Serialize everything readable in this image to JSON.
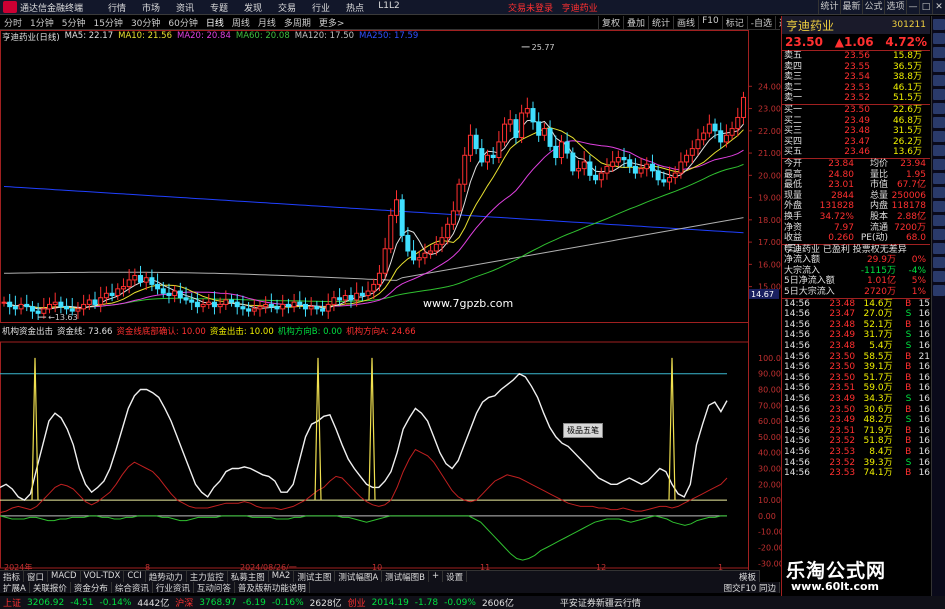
{
  "app": {
    "title": "通达信金融终端",
    "menu": [
      "行情",
      "市场",
      "资讯",
      "专题",
      "发现",
      "交易",
      "行业",
      "热点",
      "L1L2"
    ],
    "trade_warning": "交易未登录",
    "stock_in_title": "亨迪药业",
    "win_buttons": [
      "统计",
      "最新",
      "公式",
      "选项",
      "—",
      "□",
      "✕"
    ]
  },
  "toolbar": {
    "periods": [
      "分时",
      "1分钟",
      "5分钟",
      "15分钟",
      "30分钟",
      "60分钟",
      "日线",
      "周线",
      "月线",
      "多周期",
      "更多>"
    ],
    "active": "日线",
    "right": [
      "复权",
      "叠加",
      "统计",
      "画线",
      "F10",
      "标记",
      "-自选",
      "返回"
    ]
  },
  "legend": {
    "name": "亨迪药业(日线)",
    "ma5": "MA5: 22.17",
    "ma10": "MA10: 21.56",
    "ma20": "MA20: 20.84",
    "ma60": "MA60: 20.08",
    "ma120": "MA120: 17.50",
    "ma250": "MA250: 17.59"
  },
  "indicator": {
    "name": "机构资金出击",
    "line1": "资金线: 73.66",
    "line2": "资金线底部确认: 10.00",
    "line3": "资金出击: 10.00",
    "line4": "机构方向B: 0.00",
    "line5": "机构方向A: 24.66"
  },
  "chart_data": {
    "type": "candlestick",
    "price_axis": [
      "24.00",
      "23.00",
      "22.00",
      "21.00",
      "20.00",
      "19.00",
      "18.00",
      "17.00",
      "16.00",
      "15.00"
    ],
    "price_tag": "14.67",
    "high_label": "25.77",
    "low_label": "13.63",
    "ind_axis": [
      "100.00",
      "90.00",
      "80.00",
      "70.00",
      "60.00",
      "50.00",
      "40.00",
      "30.00",
      "20.00",
      "10.00",
      "0.00",
      "-10.00",
      "-20.00",
      "-30.00"
    ],
    "x_labels": [
      "2024年",
      "8",
      "2024/08/26/一",
      "10",
      "11",
      "12",
      "1"
    ],
    "watermark_center": "www.7gpzb.com",
    "closes": [
      14.3,
      14.1,
      14.0,
      14.2,
      14.1,
      13.9,
      13.8,
      14.0,
      14.2,
      14.3,
      14.1,
      14.0,
      13.9,
      14.0,
      14.2,
      14.4,
      14.2,
      14.5,
      14.7,
      14.6,
      14.9,
      15.0,
      15.3,
      15.5,
      15.2,
      15.4,
      15.1,
      14.9,
      14.7,
      14.6,
      14.8,
      14.5,
      14.4,
      14.3,
      14.1,
      14.2,
      14.3,
      14.1,
      14.2,
      14.4,
      14.3,
      14.1,
      14.0,
      13.9,
      14.0,
      14.1,
      14.2,
      14.1,
      14.0,
      14.2,
      14.1,
      14.3,
      14.2,
      14.0,
      14.1,
      14.0,
      13.9,
      14.2,
      14.5,
      14.4,
      14.6,
      14.4,
      14.7,
      14.6,
      14.8,
      15.1,
      15.6,
      16.7,
      18.2,
      18.9,
      17.3,
      16.6,
      16.2,
      16.3,
      16.5,
      16.6,
      16.9,
      17.2,
      17.8,
      18.4,
      19.6,
      20.9,
      21.8,
      21.2,
      20.6,
      20.9,
      20.8,
      21.5,
      22.3,
      22.5,
      21.7,
      22.8,
      23.0,
      22.4,
      21.8,
      22.1,
      21.3,
      20.8,
      21.5,
      21.0,
      20.2,
      20.3,
      20.6,
      20.0,
      19.8,
      20.1,
      20.4,
      20.6,
      20.8,
      20.7,
      20.4,
      20.1,
      20.3,
      20.5,
      20.2,
      19.8,
      19.7,
      19.9,
      20.1,
      20.6,
      20.9,
      21.2,
      21.6,
      21.9,
      22.3,
      22.0,
      21.5,
      21.8,
      22.1,
      22.6,
      23.5
    ],
    "white_line": [
      18,
      20,
      17,
      12,
      10,
      14,
      30,
      45,
      60,
      65,
      62,
      55,
      45,
      30,
      20,
      15,
      18,
      22,
      30,
      42,
      55,
      68,
      76,
      80,
      80,
      78,
      75,
      68,
      60,
      50,
      40,
      30,
      20,
      15,
      12,
      18,
      22,
      28,
      30,
      30,
      31,
      30,
      28,
      26,
      25,
      22,
      15,
      15,
      20,
      35,
      50,
      58,
      60,
      63,
      64,
      55,
      45,
      36,
      30,
      25,
      20,
      18,
      18,
      22,
      28,
      40,
      55,
      62,
      68,
      65,
      60,
      50,
      40,
      33,
      30,
      35,
      45,
      55,
      65,
      72,
      75,
      76,
      80,
      83,
      86,
      90,
      88,
      82,
      75,
      65,
      56,
      50,
      46,
      44,
      40,
      36,
      32,
      28,
      24,
      22,
      20,
      20,
      22,
      24,
      22,
      20,
      22,
      26,
      30,
      28,
      20,
      14,
      12,
      20,
      45,
      58,
      70,
      72,
      66,
      73
    ],
    "red_line": [
      2,
      3,
      5,
      6,
      5,
      4,
      6,
      10,
      14,
      18,
      20,
      19,
      17,
      13,
      9,
      7,
      9,
      12,
      15,
      20,
      26,
      31,
      34,
      32,
      30,
      28,
      24,
      19,
      14,
      10,
      8,
      6,
      5,
      5,
      5,
      6,
      7,
      8,
      8,
      8,
      9,
      8,
      6,
      5,
      5,
      5,
      4,
      5,
      6,
      8,
      10,
      13,
      16,
      18,
      22,
      25,
      24,
      20,
      16,
      12,
      9,
      7,
      6,
      7,
      10,
      18,
      28,
      36,
      42,
      40,
      38,
      34,
      28,
      22,
      16,
      12,
      10,
      9,
      10,
      14,
      18,
      22,
      24,
      26,
      25,
      24,
      22,
      20,
      18,
      16,
      14,
      12,
      10,
      8,
      7,
      6,
      6,
      6,
      5,
      5,
      4,
      4,
      5,
      4,
      3,
      3,
      4,
      5,
      6,
      6,
      5,
      6,
      8,
      10,
      12,
      14,
      16,
      18,
      20,
      24
    ],
    "green_line": [
      0,
      -1,
      -2,
      -2,
      -2,
      -1,
      -1,
      -2,
      -3,
      -3,
      -2,
      -2,
      -1,
      -1,
      -1,
      0,
      0,
      -1,
      -1,
      -2,
      -2,
      -1,
      -1,
      0,
      0,
      0,
      0,
      -1,
      -1,
      -2,
      -3,
      -3,
      -2,
      -1,
      -1,
      -1,
      -1,
      0,
      0,
      0,
      0,
      0,
      -1,
      -1,
      -1,
      -1,
      -2,
      -2,
      -2,
      -1,
      -1,
      0,
      0,
      0,
      0,
      0,
      0,
      -1,
      -1,
      -2,
      -3,
      -4,
      -3,
      -2,
      -1,
      0,
      0,
      0,
      0,
      0,
      0,
      0,
      0,
      0,
      0,
      0,
      0,
      0,
      0,
      -2,
      -4,
      -8,
      -12,
      -16,
      -20,
      -24,
      -27,
      -28,
      -27,
      -25,
      -22,
      -20,
      -18,
      -16,
      -14,
      -12,
      -10,
      -8,
      -6,
      -4,
      -3,
      -2,
      -2,
      -2,
      -3,
      -4,
      -3,
      -2,
      -1,
      0,
      -1,
      -2,
      -4,
      -5,
      -6,
      -5,
      -3,
      -2,
      -1,
      -1,
      0,
      0
    ],
    "spikes": [
      35,
      318,
      372,
      672
    ]
  },
  "quote": {
    "name": "亨迪药业",
    "code": "301211",
    "price": "23.50",
    "change": "1.06",
    "pct": "4.72%",
    "asks": [
      [
        "卖五",
        "23.56",
        "15.8万"
      ],
      [
        "卖四",
        "23.55",
        "36.5万"
      ],
      [
        "卖三",
        "23.54",
        "38.8万"
      ],
      [
        "卖二",
        "23.53",
        "46.1万"
      ],
      [
        "卖一",
        "23.52",
        "51.5万"
      ]
    ],
    "bids": [
      [
        "买一",
        "23.50",
        "22.6万"
      ],
      [
        "买二",
        "23.49",
        "46.8万"
      ],
      [
        "买三",
        "23.48",
        "31.5万"
      ],
      [
        "买四",
        "23.47",
        "26.2万"
      ],
      [
        "买五",
        "23.46",
        "13.6万"
      ]
    ],
    "stats": [
      [
        "今开",
        "23.84",
        "均价",
        "23.94"
      ],
      [
        "最高",
        "24.80",
        "量比",
        "1.95"
      ],
      [
        "最低",
        "23.01",
        "市值",
        "67.7亿"
      ],
      [
        "现量",
        "2844",
        "总量",
        "250006"
      ],
      [
        "外盘",
        "131828",
        "内盘",
        "118178"
      ],
      [
        "换手",
        "34.72%",
        "股本",
        "2.88亿"
      ],
      [
        "净资",
        "7.97",
        "流通",
        "7200万"
      ],
      [
        "收益(三)",
        "0.260",
        "PE(动)",
        "68.0"
      ]
    ],
    "flow_title": "亨迪药业 已盈利 投票权无差异",
    "flows": [
      [
        "净流入额",
        "29.9万",
        "0%"
      ],
      [
        "大宗流入",
        "-1115万",
        "-4%"
      ],
      [
        "5日净流入额",
        "1.01亿",
        "5%"
      ],
      [
        "5日大宗流入",
        "2720万",
        "1%"
      ]
    ],
    "ticks": [
      [
        "14:56",
        "23.48",
        "14.6万",
        "B",
        "15"
      ],
      [
        "14:56",
        "23.47",
        "27.0万",
        "S",
        "16"
      ],
      [
        "14:56",
        "23.48",
        "52.1万",
        "B",
        "16"
      ],
      [
        "14:56",
        "23.49",
        "31.7万",
        "S",
        "16"
      ],
      [
        "14:56",
        "23.48",
        "5.4万",
        "S",
        "16"
      ],
      [
        "14:56",
        "23.50",
        "58.5万",
        "B",
        "21"
      ],
      [
        "14:56",
        "23.50",
        "39.1万",
        "B",
        "16"
      ],
      [
        "14:56",
        "23.50",
        "51.7万",
        "B",
        "16"
      ],
      [
        "14:56",
        "23.51",
        "59.0万",
        "B",
        "16"
      ],
      [
        "14:56",
        "23.49",
        "34.3万",
        "S",
        "16"
      ],
      [
        "14:56",
        "23.50",
        "30.6万",
        "B",
        "16"
      ],
      [
        "14:56",
        "23.49",
        "48.2万",
        "S",
        "16"
      ],
      [
        "14:56",
        "23.51",
        "71.9万",
        "B",
        "16"
      ],
      [
        "14:56",
        "23.52",
        "51.8万",
        "B",
        "16"
      ],
      [
        "14:56",
        "23.53",
        "8.4万",
        "B",
        "16"
      ],
      [
        "14:56",
        "23.52",
        "39.3万",
        "S",
        "16"
      ],
      [
        "14:56",
        "23.53",
        "74.1万",
        "B",
        "16"
      ]
    ]
  },
  "tabs1": [
    "指标",
    "窗口",
    "MACD",
    "VOL-TDX",
    "CCI",
    "趋势动力",
    "主力监控",
    "私募主图",
    "MA2",
    "测试主图",
    "测试幅图A",
    "测试幅图B",
    "+",
    "设置"
  ],
  "tabs1_right": "模板",
  "tabs2": [
    "扩展A",
    "关联报价",
    "资金分布",
    "综合资讯",
    "行业资讯",
    "互动问答",
    "普及版新功能说明"
  ],
  "tabs2_right": "图交F10 同边",
  "status": {
    "sh": "上证",
    "sh_v": "3206.92",
    "sh_c": "-4.51",
    "sh_p": "-0.14%",
    "sh_a": "4442亿",
    "sz": "沪深",
    "sz_v": "3768.97",
    "sz_c": "-6.19",
    "sz_p": "-0.16%",
    "sz_a": "2628亿",
    "cy": "创业",
    "cy_v": "2014.19",
    "cy_c": "-1.78",
    "cy_p": "-0.09%",
    "cy_a": "2606亿",
    "broker": "平安证券新疆云行情"
  },
  "watermark": {
    "main": "乐淘公式网",
    "url": "www.60lt.com"
  },
  "five_btn": "极品五笔"
}
